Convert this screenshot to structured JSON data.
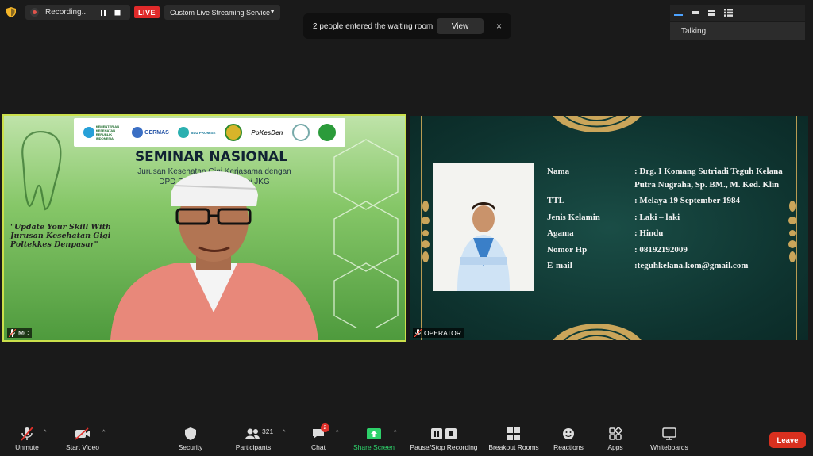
{
  "top_bar": {
    "recording_label": "Recording...",
    "live_badge": "LIVE",
    "stream_service": "Custom Live Streaming Service"
  },
  "notification": {
    "message": "2 people entered the waiting room",
    "view_label": "View",
    "close_glyph": "×"
  },
  "view_panel": {
    "talking_label": "Talking:"
  },
  "tiles": {
    "mc": {
      "name": "MC",
      "slide": {
        "title": "SEMINAR NASIONAL",
        "subtitle_line1": "Jurusan Kesehatan Gigi Kerjasama dengan",
        "subtitle_line2": "DPD PTGMI Bali & Alumni JKG",
        "tagline": "\"Update Your Skill With Jurusan Kesehatan Gigi Poltekkes Denpasar\"",
        "logos": [
          "KEMENTERIAN KESEHATAN REPUBLIK INDONESIA",
          "GERMAS",
          "BLU PROMISE",
          "",
          "PoKesDen",
          "",
          "PTGMI"
        ]
      }
    },
    "operator": {
      "name": "OPERATOR",
      "bio": [
        {
          "key": "Nama",
          "value": ": Drg. I Komang Sutriadi Teguh Kelana Putra Nugraha, Sp. BM., M. Ked. Klin"
        },
        {
          "key": "TTL",
          "value": ": Melaya 19 September 1984"
        },
        {
          "key": "Jenis Kelamin",
          "value": ": Laki – laki"
        },
        {
          "key": "Agama",
          "value": ": Hindu"
        },
        {
          "key": "Nomor Hp",
          "value": ": 08192192009"
        },
        {
          "key": "E-mail",
          "value": ":teguhkelana.kom@gmail.com"
        }
      ]
    }
  },
  "toolbar": {
    "unmute": "Unmute",
    "start_video": "Start Video",
    "security": "Security",
    "participants": "Participants",
    "participants_count": "321",
    "chat": "Chat",
    "chat_badge": "2",
    "share_screen": "Share Screen",
    "pause_stop_recording": "Pause/Stop Recording",
    "breakout_rooms": "Breakout Rooms",
    "reactions": "Reactions",
    "apps": "Apps",
    "whiteboards": "Whiteboards",
    "leave": "Leave"
  },
  "colors": {
    "live_red": "#e02a2a",
    "share_green": "#2ed06a",
    "leave_red": "#d9301f",
    "active_speaker_border": "#cbe04b"
  }
}
